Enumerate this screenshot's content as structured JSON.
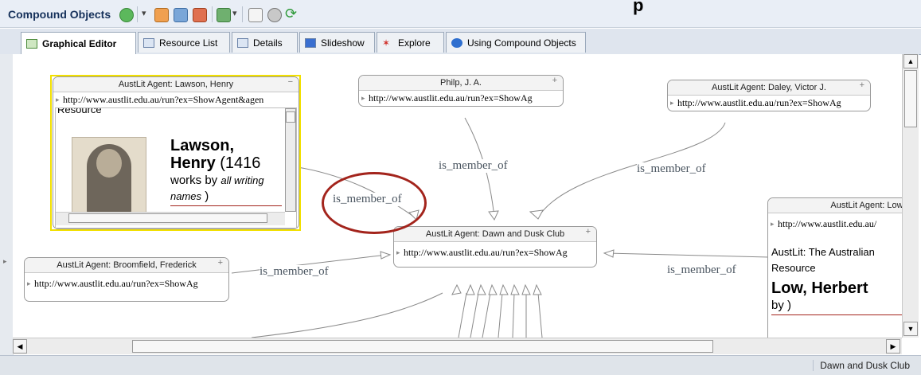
{
  "app": {
    "title": "Compound Objects",
    "watermark": "p"
  },
  "toolbar": {
    "icons": [
      "add-icon",
      "dropdown-icon",
      "new-icon",
      "save-icon",
      "export-icon",
      "publish-icon",
      "dropdown-icon",
      "document-icon",
      "settings-icon",
      "refresh-icon"
    ]
  },
  "tabs": [
    {
      "label": "Graphical Editor",
      "active": true
    },
    {
      "label": "Resource List"
    },
    {
      "label": "Details"
    },
    {
      "label": "Slideshow"
    },
    {
      "label": "Explore"
    },
    {
      "label": "Using Compound Objects"
    }
  ],
  "nodes": {
    "lawson": {
      "title": "AustLit Agent: Lawson, Henry",
      "url": "http://www.austlit.edu.au/run?ex=ShowAgent&agen",
      "preview_heading": "Resource",
      "name": "Lawson,",
      "name2": "Henry",
      "count": " (1416",
      "works_by": "works by ",
      "all_writing": "all writing",
      "names": "names",
      "close_paren": " )"
    },
    "philp": {
      "title": "Philp, J. A.",
      "url": "http://www.austlit.edu.au/run?ex=ShowAg"
    },
    "daley": {
      "title": "AustLit Agent: Daley, Victor J.",
      "url": "http://www.austlit.edu.au/run?ex=ShowAg"
    },
    "dawn": {
      "title": "AustLit Agent: Dawn and Dusk Club",
      "url": "http://www.austlit.edu.au/run?ex=ShowAg"
    },
    "broomfield": {
      "title": "AustLit Agent: Broomfield, Frederick",
      "url": "http://www.austlit.edu.au/run?ex=ShowAg"
    },
    "low": {
      "title": "AustLit Agent: Low,",
      "url": "http://www.austlit.edu.au/",
      "line1": "AustLit: The Australian",
      "line2": "Resource",
      "name": "Low, Herbert",
      "by": "by )"
    }
  },
  "edges": {
    "label": "is_member_of"
  },
  "status": {
    "text": "Dawn and Dusk Club"
  },
  "colors": {
    "selection": "#f2e000",
    "annotation_circle": "#a3241c",
    "toolbar_bg": "#e9eef6"
  }
}
